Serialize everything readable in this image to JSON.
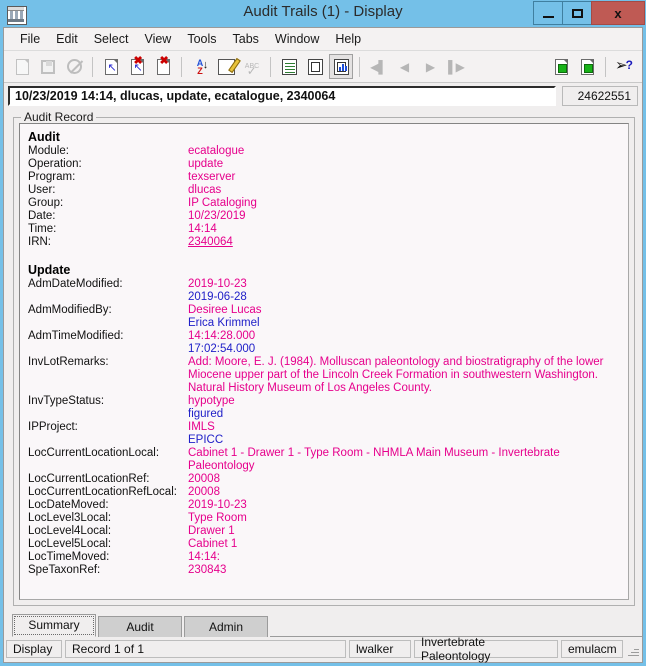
{
  "window": {
    "title": "Audit Trails (1) - Display",
    "icon": "museum-building-icon",
    "minimize_label": "",
    "maximize_label": "",
    "close_label": "x"
  },
  "menu": {
    "items": [
      {
        "label": "File"
      },
      {
        "label": "Edit"
      },
      {
        "label": "Select"
      },
      {
        "label": "View"
      },
      {
        "label": "Tools"
      },
      {
        "label": "Tabs"
      },
      {
        "label": "Window"
      },
      {
        "label": "Help"
      }
    ]
  },
  "toolbar": {
    "buttons": [
      {
        "name": "new-record-icon",
        "enabled": false
      },
      {
        "name": "save-icon",
        "enabled": false
      },
      {
        "name": "cancel-icon",
        "enabled": false
      },
      {
        "name": "insert-record-icon",
        "enabled": true
      },
      {
        "name": "delete-record-icon",
        "enabled": true
      },
      {
        "name": "remove-record-icon",
        "enabled": true
      },
      {
        "name": "sort-az-icon",
        "enabled": true
      },
      {
        "name": "edit-note-icon",
        "enabled": true
      },
      {
        "name": "spellcheck-icon",
        "enabled": false
      },
      {
        "name": "view-list-icon",
        "enabled": true
      },
      {
        "name": "view-page-icon",
        "enabled": true
      },
      {
        "name": "view-report-icon",
        "enabled": true,
        "selected": true
      },
      {
        "name": "first-record-icon",
        "enabled": false
      },
      {
        "name": "previous-record-icon",
        "enabled": false
      },
      {
        "name": "next-record-icon",
        "enabled": false
      },
      {
        "name": "last-record-icon",
        "enabled": false
      },
      {
        "name": "copy-record-icon",
        "enabled": true
      },
      {
        "name": "duplicate-record-icon",
        "enabled": true
      },
      {
        "name": "context-help-icon",
        "enabled": true
      }
    ]
  },
  "record_header": {
    "summary": "10/23/2019 14:14, dlucas, update, ecatalogue, 2340064",
    "irn_number": "24622551"
  },
  "group": {
    "legend": "Audit Record"
  },
  "sections": {
    "audit": {
      "title": "Audit",
      "rows": [
        {
          "label": "Module:",
          "new": "ecatalogue"
        },
        {
          "label": "Operation:",
          "new": "update"
        },
        {
          "label": "Program:",
          "new": "texserver"
        },
        {
          "label": "User:",
          "new": "dlucas"
        },
        {
          "label": "Group:",
          "new": "IP Cataloging"
        },
        {
          "label": "Date:",
          "new": "10/23/2019"
        },
        {
          "label": "Time:",
          "new": "14:14"
        },
        {
          "label": "IRN:",
          "new": "2340064",
          "link": true
        }
      ]
    },
    "update": {
      "title": "Update",
      "rows": [
        {
          "label": "AdmDateModified:",
          "new": "2019-10-23",
          "old": "2019-06-28"
        },
        {
          "label": "AdmModifiedBy:",
          "new": "Desiree Lucas",
          "old": "Erica Krimmel"
        },
        {
          "label": "AdmTimeModified:",
          "new": "14:14:28.000",
          "old": "17:02:54.000"
        },
        {
          "label": "InvLotRemarks:",
          "new": "Add: Moore, E. J. (1984). Molluscan paleontology and biostratigraphy of the lower Miocene upper part of the Lincoln Creek Formation in southwestern Washington. Natural History Museum of Los Angeles County.",
          "wrap": true
        },
        {
          "label": "InvTypeStatus:",
          "new": "hypotype",
          "old": "figured"
        },
        {
          "label": "IPProject:",
          "new": "IMLS",
          "old": "EPICC"
        },
        {
          "label": "LocCurrentLocationLocal:",
          "new": "Cabinet 1 - Drawer 1 - Type Room - NHMLA Main Museum - Invertebrate Paleontology"
        },
        {
          "label": "LocCurrentLocationRef:",
          "new": "20008"
        },
        {
          "label": "LocCurrentLocationRefLocal:",
          "new": "20008"
        },
        {
          "label": "LocDateMoved:",
          "new": "2019-10-23"
        },
        {
          "label": "LocLevel3Local:",
          "new": "Type Room"
        },
        {
          "label": "LocLevel4Local:",
          "new": "Drawer 1"
        },
        {
          "label": "LocLevel5Local:",
          "new": "Cabinet 1"
        },
        {
          "label": "LocTimeMoved:",
          "new": "14:14:"
        },
        {
          "label": "SpeTaxonRef:",
          "new": "230843"
        }
      ]
    }
  },
  "tabs": [
    {
      "label": "Summary",
      "active": true
    },
    {
      "label": "Audit",
      "active": false
    },
    {
      "label": "Admin",
      "active": false
    }
  ],
  "status": {
    "mode": "Display",
    "record": "Record 1 of 1",
    "user": "lwalker",
    "department": "Invertebrate Paleontology",
    "database": "emulacm"
  },
  "colors": {
    "new_value": "#e6008c",
    "old_value": "#2020c8",
    "title_bar": "#74c0e8",
    "close_button": "#bf5a54"
  }
}
